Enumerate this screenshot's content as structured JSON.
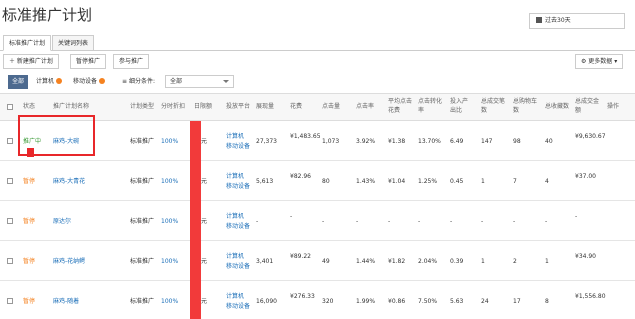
{
  "page": {
    "title": "标准推广计划",
    "date_range": "过去30天"
  },
  "tabs": [
    "标准推广计划",
    "关键词列表"
  ],
  "toolbar": {
    "new_label": "新建推广计划",
    "pause_label": "暂停推广",
    "join_label": "参与推广",
    "more_label": "更多数据"
  },
  "filter": {
    "items": [
      "全部",
      "计算机",
      "移动设备"
    ],
    "segment_label": "细分条件:",
    "segment_value": "全部"
  },
  "table": {
    "headers": [
      "状态",
      "推广计划名称",
      "计划类型",
      "分时折扣",
      "日限额",
      "投放平台",
      "展现量",
      "花费",
      "点击量",
      "点击率",
      "平均点击花费",
      "点击转化率",
      "投入产出比",
      "总成交笔数",
      "总购物车数",
      "总收藏数",
      "总成交金额",
      "操作"
    ],
    "rows": [
      {
        "status": "推广中",
        "status_type": "on",
        "name": "麻鸡-大碗",
        "type": "标准推广",
        "discount": "100%",
        "limit": "元",
        "platform_a": "计算机",
        "platform_b": "移动设备",
        "impressions": "27,373",
        "cost": "¥1,483.65",
        "clicks": "1,073",
        "ctr": "3.92%",
        "cpc": "¥1.38",
        "cvr": "13.70%",
        "roi": "6.49",
        "orders": "147",
        "carts": "98",
        "favs": "40",
        "revenue": "¥9,630.67"
      },
      {
        "status": "暂停",
        "status_type": "off",
        "name": "麻鸡-大青花",
        "type": "标准推广",
        "discount": "100%",
        "limit": "元",
        "platform_a": "计算机",
        "platform_b": "移动设备",
        "impressions": "5,613",
        "cost": "¥82.96",
        "clicks": "80",
        "ctr": "1.43%",
        "cpc": "¥1.04",
        "cvr": "1.25%",
        "roi": "0.45",
        "orders": "1",
        "carts": "7",
        "favs": "4",
        "revenue": "¥37.00"
      },
      {
        "status": "暂停",
        "status_type": "off",
        "name": "原达尔",
        "type": "标准推广",
        "discount": "100%",
        "limit": "元",
        "platform_a": "计算机",
        "platform_b": "移动设备",
        "impressions": "-",
        "cost": "-",
        "clicks": "-",
        "ctr": "-",
        "cpc": "-",
        "cvr": "-",
        "roi": "-",
        "orders": "-",
        "carts": "-",
        "favs": "-",
        "revenue": "-"
      },
      {
        "status": "暂停",
        "status_type": "off",
        "name": "麻鸡-花纳鳄",
        "type": "标准推广",
        "discount": "100%",
        "limit": "元",
        "platform_a": "计算机",
        "platform_b": "移动设备",
        "impressions": "3,401",
        "cost": "¥89.22",
        "clicks": "49",
        "ctr": "1.44%",
        "cpc": "¥1.82",
        "cvr": "2.04%",
        "roi": "0.39",
        "orders": "1",
        "carts": "2",
        "favs": "1",
        "revenue": "¥34.90"
      },
      {
        "status": "暂停",
        "status_type": "off",
        "name": "麻鸡-随着",
        "type": "标准推广",
        "discount": "100%",
        "limit": "元",
        "platform_a": "计算机",
        "platform_b": "移动设备",
        "impressions": "16,090",
        "cost": "¥276.33",
        "clicks": "320",
        "ctr": "1.99%",
        "cpc": "¥0.86",
        "cvr": "7.50%",
        "roi": "5.63",
        "orders": "24",
        "carts": "17",
        "favs": "8",
        "revenue": "¥1,556.80"
      }
    ]
  },
  "colors": {
    "accent": "#4d6a8f",
    "status_on": "#3a9a36",
    "status_off": "#f58220",
    "link": "#1a6eb8",
    "highlight": "#e8272a"
  }
}
